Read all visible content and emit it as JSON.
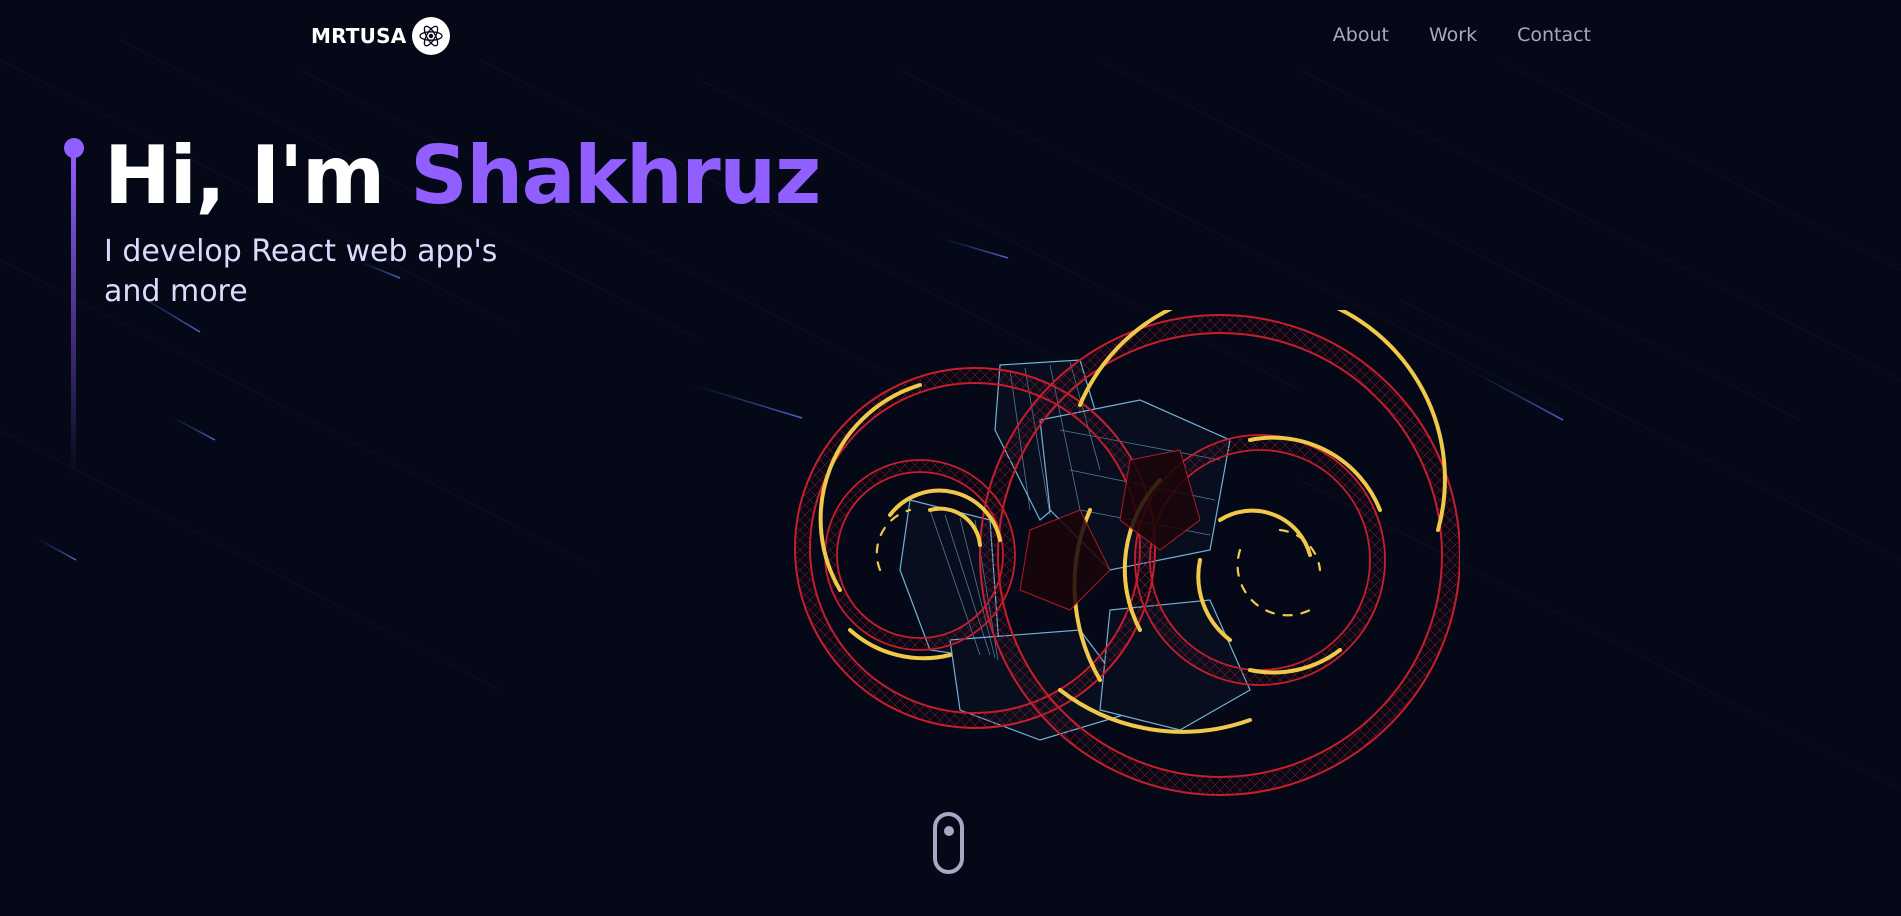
{
  "theme": {
    "background": "#050816",
    "accent": "#915eff",
    "nav_text": "#aaa6c3",
    "subtitle_text": "#dfd9ff"
  },
  "navbar": {
    "brand": "MRTUSA",
    "brand_icon": "atom-icon",
    "links": [
      {
        "label": "About"
      },
      {
        "label": "Work"
      },
      {
        "label": "Contact"
      }
    ]
  },
  "hero": {
    "title_prefix": "Hi, I'm ",
    "title_name": "Shakhruz",
    "subtitle_line1": "I develop React web app's",
    "subtitle_line2": "and more"
  },
  "model": {
    "icon": "wireframe-gear-model",
    "ring_color": "#c81e2d",
    "arc_color": "#f0c94a",
    "core_color": "#7fc3e8"
  },
  "scroll": {
    "icon": "mouse-scroll-icon"
  }
}
